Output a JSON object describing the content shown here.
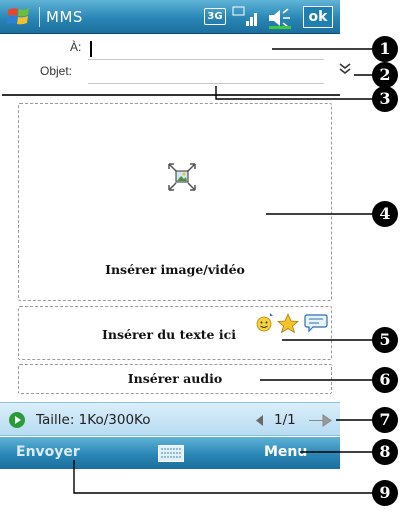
{
  "titlebar": {
    "app_title": "MMS",
    "network_badge": "3G",
    "ok_label": "ok",
    "icons": [
      "windows-start-icon",
      "signal-icon",
      "volume-icon"
    ]
  },
  "header": {
    "to_label": "À:",
    "to_value": "",
    "subject_label": "Objet:",
    "subject_value": ""
  },
  "content": {
    "insert_image_label": "Insérer image/vidéo",
    "insert_text_label": "Insérer du texte ici",
    "insert_audio_label": "Insérer audio"
  },
  "status": {
    "size_text": "Taille: 1Ko/300Ko",
    "page_text": "1/1"
  },
  "softkeys": {
    "left": "Envoyer",
    "right": "Menu"
  },
  "callouts": [
    "1",
    "2",
    "3",
    "4",
    "5",
    "6",
    "7",
    "8",
    "9"
  ],
  "colors": {
    "titlebar": "#2a86b6",
    "statusbar": "#c9e6f7",
    "play": "#2a9a3a"
  }
}
